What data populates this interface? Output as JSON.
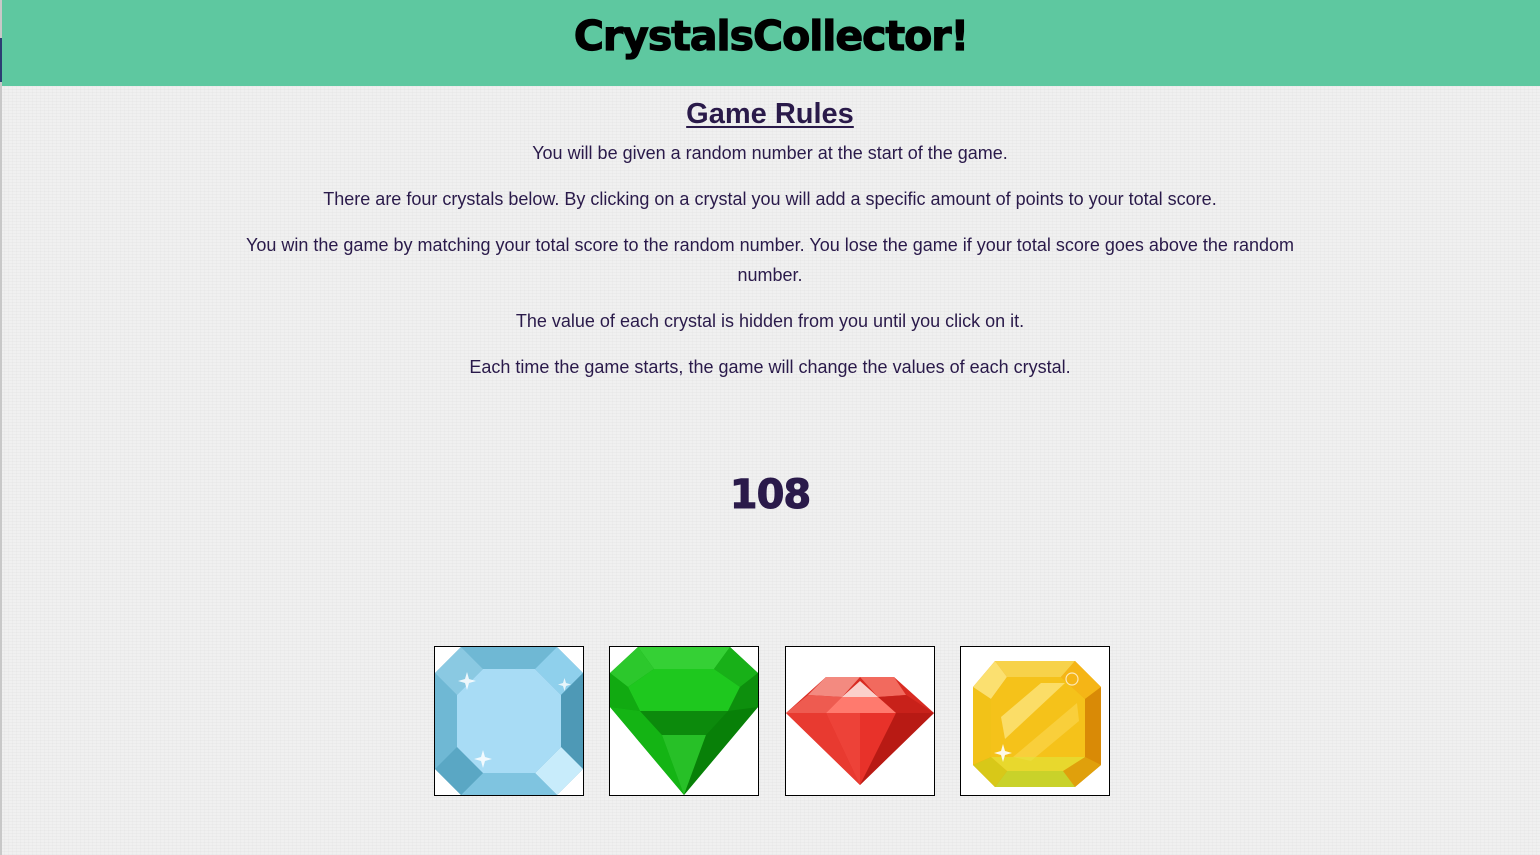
{
  "header": {
    "title": "CrystalsCollector!",
    "background_color": "#5ec8a0"
  },
  "rules": {
    "heading": "Game Rules",
    "items": [
      "You will be given a random number at the start of the game.",
      "There are four crystals below. By clicking on a crystal you will add a specific amount of points to your total score.",
      "You win the game by matching your total score to the random number. You lose the game if your total score goes above the random number.",
      "The value of each crystal is hidden from you until you click on it.",
      "Each time the game starts, the game will change the values of each crystal."
    ]
  },
  "game": {
    "target_number": "108",
    "crystals": [
      {
        "name": "blue-crystal",
        "color": "#a8dcf5"
      },
      {
        "name": "green-crystal",
        "color": "#1ec81e"
      },
      {
        "name": "red-crystal",
        "color": "#e8322a"
      },
      {
        "name": "yellow-crystal",
        "color": "#f5c21a"
      }
    ]
  }
}
